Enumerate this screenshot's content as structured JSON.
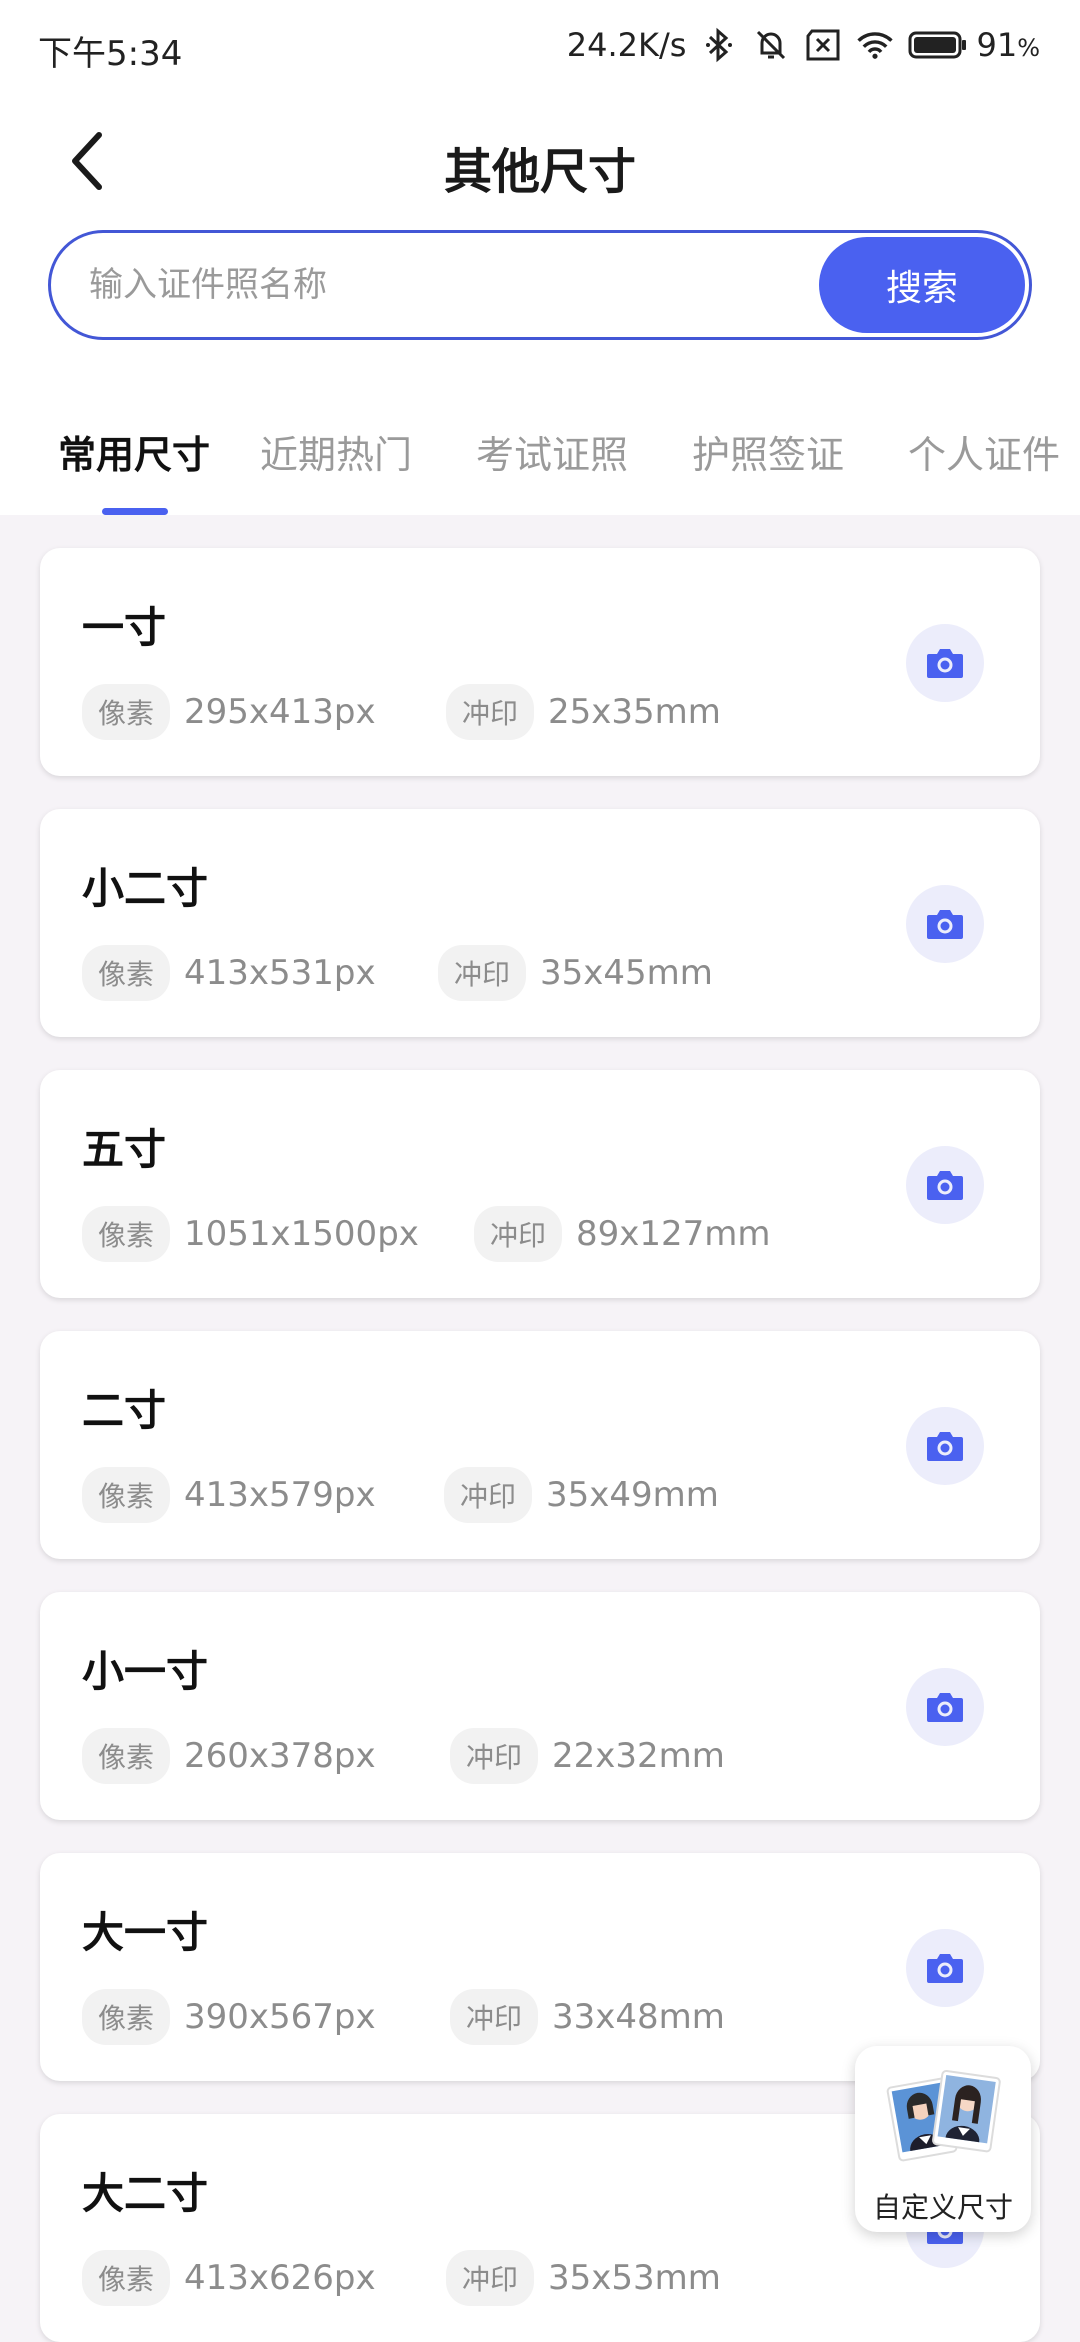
{
  "status_bar": {
    "time": "下午5:34",
    "speed": "24.2K/s",
    "battery": "91",
    "battery_unit": "%"
  },
  "header": {
    "title": "其他尺寸"
  },
  "search": {
    "placeholder": "输入证件照名称",
    "button_label": "搜索"
  },
  "tabs": [
    {
      "label": "常用尺寸",
      "active": true
    },
    {
      "label": "近期热门",
      "active": false
    },
    {
      "label": "考试证照",
      "active": false
    },
    {
      "label": "护照签证",
      "active": false
    },
    {
      "label": "个人证件",
      "active": false
    }
  ],
  "spec_labels": {
    "pixels": "像素",
    "print": "冲印"
  },
  "items": [
    {
      "name": "一寸",
      "pixels": "295x413px",
      "print": "25x35mm"
    },
    {
      "name": "小二寸",
      "pixels": "413x531px",
      "print": "35x45mm"
    },
    {
      "name": "五寸",
      "pixels": "1051x1500px",
      "print": "89x127mm"
    },
    {
      "name": "二寸",
      "pixels": "413x579px",
      "print": "35x49mm"
    },
    {
      "name": "小一寸",
      "pixels": "260x378px",
      "print": "22x32mm"
    },
    {
      "name": "大一寸",
      "pixels": "390x567px",
      "print": "33x48mm"
    },
    {
      "name": "大二寸",
      "pixels": "413x626px",
      "print": "35x53mm"
    }
  ],
  "fab": {
    "label": "自定义尺寸"
  },
  "colors": {
    "accent": "#4a61f0",
    "border": "#4357d6",
    "page_bg": "#f6f3f7"
  }
}
